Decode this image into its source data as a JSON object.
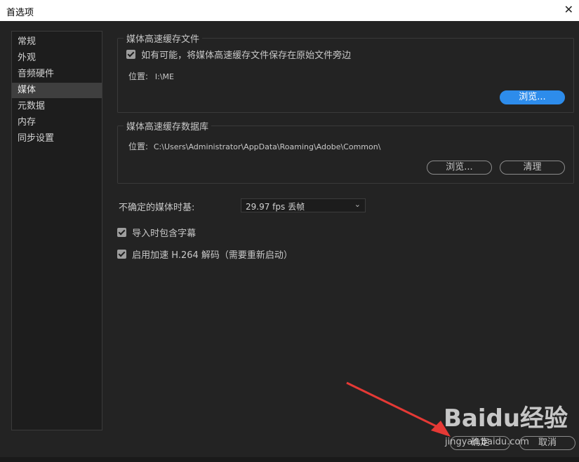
{
  "window": {
    "title": "首选项"
  },
  "sidebar": {
    "items": [
      {
        "label": "常规"
      },
      {
        "label": "外观"
      },
      {
        "label": "音频硬件"
      },
      {
        "label": "媒体"
      },
      {
        "label": "元数据"
      },
      {
        "label": "内存"
      },
      {
        "label": "同步设置"
      }
    ],
    "active_index": 3
  },
  "media_cache_files": {
    "title": "媒体高速缓存文件",
    "save_next_to_originals_label": "如有可能，将媒体高速缓存文件保存在原始文件旁边",
    "save_next_to_originals_checked": true,
    "location_label": "位置:",
    "location_value": "I:\\ME",
    "browse_label": "浏览..."
  },
  "media_cache_database": {
    "title": "媒体高速缓存数据库",
    "location_label": "位置:",
    "location_value": "C:\\Users\\Administrator\\AppData\\Roaming\\Adobe\\Common\\",
    "browse_label": "浏览...",
    "clean_label": "清理"
  },
  "timebase": {
    "label": "不确定的媒体时基:",
    "selected": "29.97  fps 丢帧"
  },
  "options": {
    "include_captions_label": "导入时包含字幕",
    "include_captions_checked": true,
    "hardware_h264_label": "启用加速 H.264 解码（需要重新启动）",
    "hardware_h264_checked": true
  },
  "footer": {
    "ok_label": "确定",
    "cancel_label": "取消"
  },
  "watermark": {
    "logo_text": "Baidu经验",
    "url_text": "jingyan.baidu.com"
  },
  "colors": {
    "accent": "#2d8ceb",
    "background": "#232323",
    "arrow": "#e53935"
  }
}
